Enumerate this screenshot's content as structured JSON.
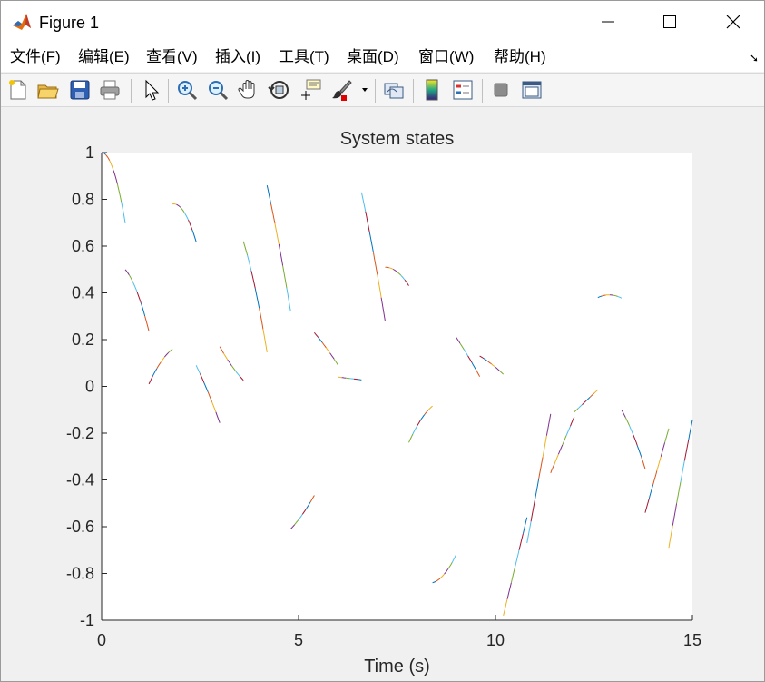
{
  "window": {
    "title": "Figure 1",
    "icon": "matlab-logo-icon",
    "controls": [
      "minimize-icon",
      "maximize-icon",
      "close-icon"
    ]
  },
  "menu": {
    "items": [
      "文件(F)",
      "编辑(E)",
      "查看(V)",
      "插入(I)",
      "工具(T)",
      "桌面(D)",
      "窗口(W)",
      "帮助(H)"
    ],
    "overflow_icon": "dock-arrow-icon"
  },
  "toolbar": {
    "buttons": [
      "new-figure-icon",
      "open-file-icon",
      "save-icon",
      "print-icon",
      "edit-plot-icon",
      "zoom-in-icon",
      "zoom-out-icon",
      "pan-icon",
      "rotate-3d-icon",
      "data-cursor-icon",
      "brush-icon",
      "link-plot-icon",
      "colorbar-icon",
      "legend-icon",
      "hide-plot-tools-icon",
      "show-plot-tools-icon"
    ]
  },
  "chart_data": {
    "type": "line",
    "title": "System states",
    "xlabel": "Time (s)",
    "ylabel": "",
    "xlim": [
      0,
      15
    ],
    "ylim": [
      -1,
      1
    ],
    "xticks": [
      "0",
      "5",
      "10",
      "15"
    ],
    "yticks": [
      "-1",
      "-0.8",
      "-0.6",
      "-0.4",
      "-0.2",
      "0",
      "0.2",
      "0.4",
      "0.6",
      "0.8",
      "1"
    ],
    "grid": false,
    "legend": "none",
    "colors": [
      "#0072BD",
      "#D95319",
      "#EDB120",
      "#7E2F8E",
      "#77AC30",
      "#4DBEEE",
      "#A2142F"
    ],
    "segments": [
      {
        "x0": 0.0,
        "x1": 0.6,
        "a": 1.0,
        "b": 0.0,
        "c": -0.84
      },
      {
        "x0": 0.6,
        "x1": 1.2,
        "a": 0.5,
        "b": -0.2,
        "c": -0.4
      },
      {
        "x0": 1.2,
        "x1": 1.8,
        "a": 0.01,
        "b": 0.37,
        "c": -0.2
      },
      {
        "x0": 1.8,
        "x1": 2.4,
        "a": 0.78,
        "b": 0.03,
        "c": -0.5
      },
      {
        "x0": 2.4,
        "x1": 3.0,
        "a": 0.09,
        "b": -0.35,
        "c": -0.1
      },
      {
        "x0": 3.0,
        "x1": 3.6,
        "a": 0.17,
        "b": -0.3,
        "c": 0.1
      },
      {
        "x0": 3.6,
        "x1": 4.2,
        "a": 0.62,
        "b": -0.55,
        "c": -0.4
      },
      {
        "x0": 4.2,
        "x1": 4.8,
        "a": 0.86,
        "b": -0.78,
        "c": -0.2
      },
      {
        "x0": 4.8,
        "x1": 5.4,
        "a": -0.61,
        "b": 0.18,
        "c": 0.1
      },
      {
        "x0": 5.4,
        "x1": 6.0,
        "a": 0.23,
        "b": -0.2,
        "c": -0.05
      },
      {
        "x0": 6.0,
        "x1": 6.6,
        "a": 0.04,
        "b": -0.02,
        "c": 0.0
      },
      {
        "x0": 6.6,
        "x1": 7.2,
        "a": 0.83,
        "b": -0.8,
        "c": -0.2
      },
      {
        "x0": 7.2,
        "x1": 7.8,
        "a": 0.51,
        "b": 0.0,
        "c": -0.22
      },
      {
        "x0": 7.8,
        "x1": 8.4,
        "a": -0.24,
        "b": 0.38,
        "c": -0.2
      },
      {
        "x0": 8.4,
        "x1": 9.0,
        "a": -0.84,
        "b": 0.05,
        "c": 0.25
      },
      {
        "x0": 9.0,
        "x1": 9.6,
        "a": 0.21,
        "b": -0.25,
        "c": -0.05
      },
      {
        "x0": 9.6,
        "x1": 10.2,
        "a": 0.13,
        "b": -0.1,
        "c": -0.05
      },
      {
        "x0": 10.2,
        "x1": 10.8,
        "a": -0.98,
        "b": 0.7,
        "c": 0.0
      },
      {
        "x0": 10.8,
        "x1": 11.4,
        "a": -0.67,
        "b": 0.92,
        "c": 0.0
      },
      {
        "x0": 11.4,
        "x1": 12.0,
        "a": -0.37,
        "b": 0.4,
        "c": 0.0
      },
      {
        "x0": 12.0,
        "x1": 12.6,
        "a": -0.11,
        "b": 0.16,
        "c": 0.0
      },
      {
        "x0": 12.6,
        "x1": 13.2,
        "a": 0.38,
        "b": 0.08,
        "c": -0.14
      },
      {
        "x0": 13.2,
        "x1": 13.8,
        "a": -0.1,
        "b": -0.3,
        "c": -0.2
      },
      {
        "x0": 13.8,
        "x1": 14.4,
        "a": -0.54,
        "b": 0.6,
        "c": 0.0
      },
      {
        "x0": 14.4,
        "x1": 15.0,
        "a": -0.69,
        "b": 0.97,
        "c": -0.1
      }
    ]
  }
}
